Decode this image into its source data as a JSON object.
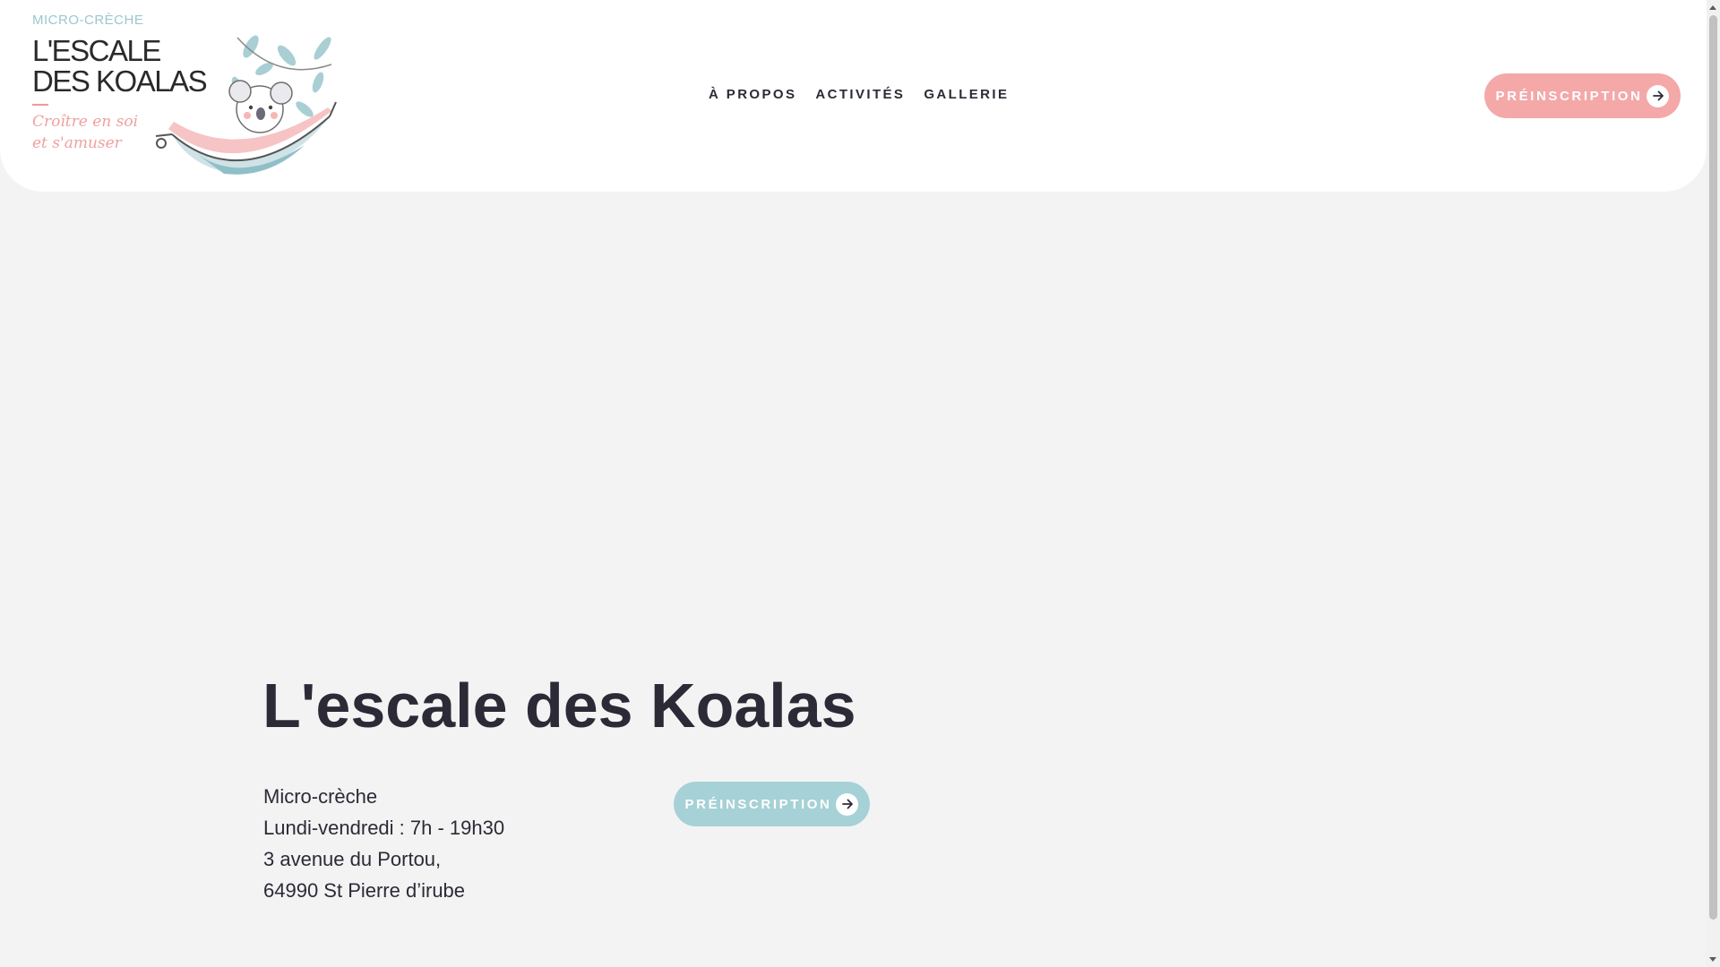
{
  "logo": {
    "small_text": "MICRO-CRÈCHE",
    "line1": "L'ESCALE",
    "line2": "DES KOALAS",
    "tagline1": "Croître en soi",
    "tagline2": "et s'amuser"
  },
  "nav": {
    "items": [
      {
        "label": "À PROPOS"
      },
      {
        "label": "ACTIVITÉS"
      },
      {
        "label": "GALLERIE"
      }
    ]
  },
  "header_button": {
    "label": "PRÉINSCRIPTION",
    "icon": "arrow-right-icon"
  },
  "hero": {
    "title": "L'escale des Koalas",
    "lines": [
      "Micro-crèche",
      "Lundi-vendredi : 7h - 19h30",
      "3 avenue du Portou,",
      "64990 St Pierre d’irube"
    ],
    "button": {
      "label": "PRÉINSCRIPTION",
      "icon": "arrow-right-icon"
    }
  },
  "colors": {
    "page_background": "#f3f3f3",
    "header_background": "#ffffff",
    "text": "#2c2a36",
    "pink_button": "#f4a8a8",
    "teal_button": "#a6d1d6"
  }
}
